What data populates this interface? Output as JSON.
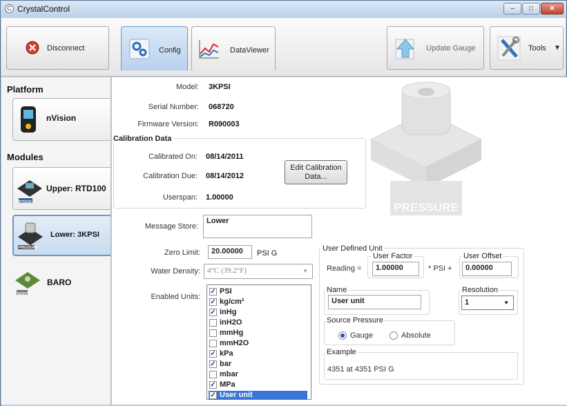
{
  "window": {
    "title": "CrystalControl",
    "title_icon": "gauge-icon",
    "minimize": "‒",
    "maximize": "□",
    "close": "✕"
  },
  "toolbar": {
    "disconnect": "Disconnect",
    "tabs": [
      {
        "label": "Config",
        "active": true
      },
      {
        "label": "DataViewer",
        "active": false
      }
    ],
    "update_gauge": "Update Gauge",
    "tools": "Tools",
    "tools_arrow": "▼"
  },
  "sidebar": {
    "platform_heading": "Platform",
    "platform_items": [
      {
        "label": "nVision",
        "icon": "nvision-device-icon"
      }
    ],
    "modules_heading": "Modules",
    "module_items": [
      {
        "label": "Upper: RTD100",
        "badge": "RTD100",
        "active": false
      },
      {
        "label": "Lower: 3KPSI",
        "badge": "PRESSURE",
        "active": true
      },
      {
        "label": "BARO",
        "badge": "BARO",
        "active": false
      }
    ]
  },
  "info": {
    "model_label": "Model:",
    "model": "3KPSI",
    "serial_label": "Serial Number:",
    "serial": "068720",
    "firmware_label": "Firmware Version:",
    "firmware": "R090003"
  },
  "calibration": {
    "title": "Calibration Data",
    "calibrated_on_label": "Calibrated On:",
    "calibrated_on": "08/14/2011",
    "due_label": "Calibration Due:",
    "due": "08/14/2012",
    "userspan_label": "Userspan:",
    "userspan": "1.00000",
    "edit_button": "Edit Calibration Data..."
  },
  "module_image": {
    "text": "PRESSURE"
  },
  "message_store": {
    "label": "Message Store:",
    "value": "Lower"
  },
  "zero_limit": {
    "label": "Zero Limit:",
    "value": "20.00000",
    "unit": "PSI G"
  },
  "water_density": {
    "label": "Water Density:",
    "value": "4°C (39.2°F)",
    "arrow": "▼"
  },
  "enabled_units": {
    "label": "Enabled Units:",
    "units": [
      {
        "name": "PSI",
        "checked": true
      },
      {
        "name": "kg/cm²",
        "checked": true
      },
      {
        "name": "inHg",
        "checked": true
      },
      {
        "name": "inH2O",
        "checked": false
      },
      {
        "name": "mmHg",
        "checked": false
      },
      {
        "name": "mmH2O",
        "checked": false
      },
      {
        "name": "kPa",
        "checked": true
      },
      {
        "name": "bar",
        "checked": true
      },
      {
        "name": "mbar",
        "checked": false
      },
      {
        "name": "MPa",
        "checked": true
      },
      {
        "name": "User unit",
        "checked": true,
        "selected": true
      }
    ]
  },
  "user_defined": {
    "title": "User Defined Unit",
    "reading_label": "Reading =",
    "factor_title": "User Factor",
    "factor": "1.00000",
    "psi_plus": "* PSI +",
    "offset_title": "User Offset",
    "offset": "0.00000",
    "name_title": "Name",
    "name": "User unit",
    "resolution_title": "Resolution",
    "resolution": "1",
    "resolution_arrow": "▼",
    "source_title": "Source Pressure",
    "gauge": "Gauge",
    "absolute": "Absolute",
    "source_selected": "Gauge",
    "example_title": "Example",
    "example": "4351 at 4351 PSI G"
  }
}
